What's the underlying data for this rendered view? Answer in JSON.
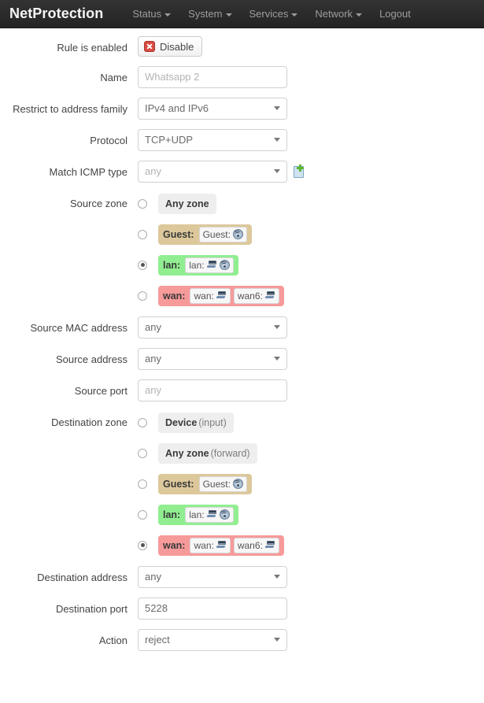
{
  "navbar": {
    "brand": "NetProtection",
    "items": [
      {
        "label": "Status",
        "has_caret": true
      },
      {
        "label": "System",
        "has_caret": true
      },
      {
        "label": "Services",
        "has_caret": true
      },
      {
        "label": "Network",
        "has_caret": true
      },
      {
        "label": "Logout",
        "has_caret": false
      }
    ]
  },
  "form": {
    "rule_enabled": {
      "label": "Rule is enabled",
      "button_label": "Disable",
      "icon": "stop-icon"
    },
    "name": {
      "label": "Name",
      "value": "Whatsapp 2",
      "is_placeholder": true
    },
    "address_family": {
      "label": "Restrict to address family",
      "value": "IPv4 and IPv6"
    },
    "protocol": {
      "label": "Protocol",
      "value": "TCP+UDP"
    },
    "icmp_type": {
      "label": "Match ICMP type",
      "value": "any",
      "add_icon": "add-page-icon"
    },
    "source_zone": {
      "label": "Source zone",
      "options": [
        {
          "name": "Any zone",
          "sub": "",
          "style": "plain",
          "selected": false,
          "interfaces": []
        },
        {
          "name": "Guest:",
          "sub": "",
          "style": "guest",
          "selected": false,
          "interfaces": [
            {
              "label": "Guest:",
              "icons": [
                "wifi-icon"
              ]
            }
          ]
        },
        {
          "name": "lan:",
          "sub": "",
          "style": "lan",
          "selected": true,
          "interfaces": [
            {
              "label": "lan:",
              "icons": [
                "ethernet-icon",
                "wifi-icon"
              ]
            }
          ]
        },
        {
          "name": "wan:",
          "sub": "",
          "style": "wan",
          "selected": false,
          "interfaces": [
            {
              "label": "wan:",
              "icons": [
                "ethernet-icon"
              ]
            },
            {
              "label": "wan6:",
              "icons": [
                "ethernet-icon"
              ]
            }
          ]
        }
      ]
    },
    "source_mac": {
      "label": "Source MAC address",
      "value": "any"
    },
    "source_address": {
      "label": "Source address",
      "value": "any"
    },
    "source_port": {
      "label": "Source port",
      "value": "any",
      "is_placeholder": true
    },
    "destination_zone": {
      "label": "Destination zone",
      "options": [
        {
          "name": "Device",
          "sub": "(input)",
          "style": "plain",
          "selected": false,
          "interfaces": []
        },
        {
          "name": "Any zone",
          "sub": "(forward)",
          "style": "plain",
          "selected": false,
          "interfaces": []
        },
        {
          "name": "Guest:",
          "sub": "",
          "style": "guest",
          "selected": false,
          "interfaces": [
            {
              "label": "Guest:",
              "icons": [
                "wifi-icon"
              ]
            }
          ]
        },
        {
          "name": "lan:",
          "sub": "",
          "style": "lan",
          "selected": false,
          "interfaces": [
            {
              "label": "lan:",
              "icons": [
                "ethernet-icon",
                "wifi-icon"
              ]
            }
          ]
        },
        {
          "name": "wan:",
          "sub": "",
          "style": "wan",
          "selected": true,
          "interfaces": [
            {
              "label": "wan:",
              "icons": [
                "ethernet-icon"
              ]
            },
            {
              "label": "wan6:",
              "icons": [
                "ethernet-icon"
              ]
            }
          ]
        }
      ]
    },
    "destination_address": {
      "label": "Destination address",
      "value": "any"
    },
    "destination_port": {
      "label": "Destination port",
      "value": "5228",
      "is_placeholder": false
    },
    "action": {
      "label": "Action",
      "value": "reject"
    }
  },
  "colors": {
    "navbar_bg": "#2b2b2b",
    "zone_guest": "#ddc89b",
    "zone_lan": "#90ee90",
    "zone_wan": "#f79a9a",
    "zone_plain": "#eeeeee",
    "danger": "#d94a41"
  }
}
